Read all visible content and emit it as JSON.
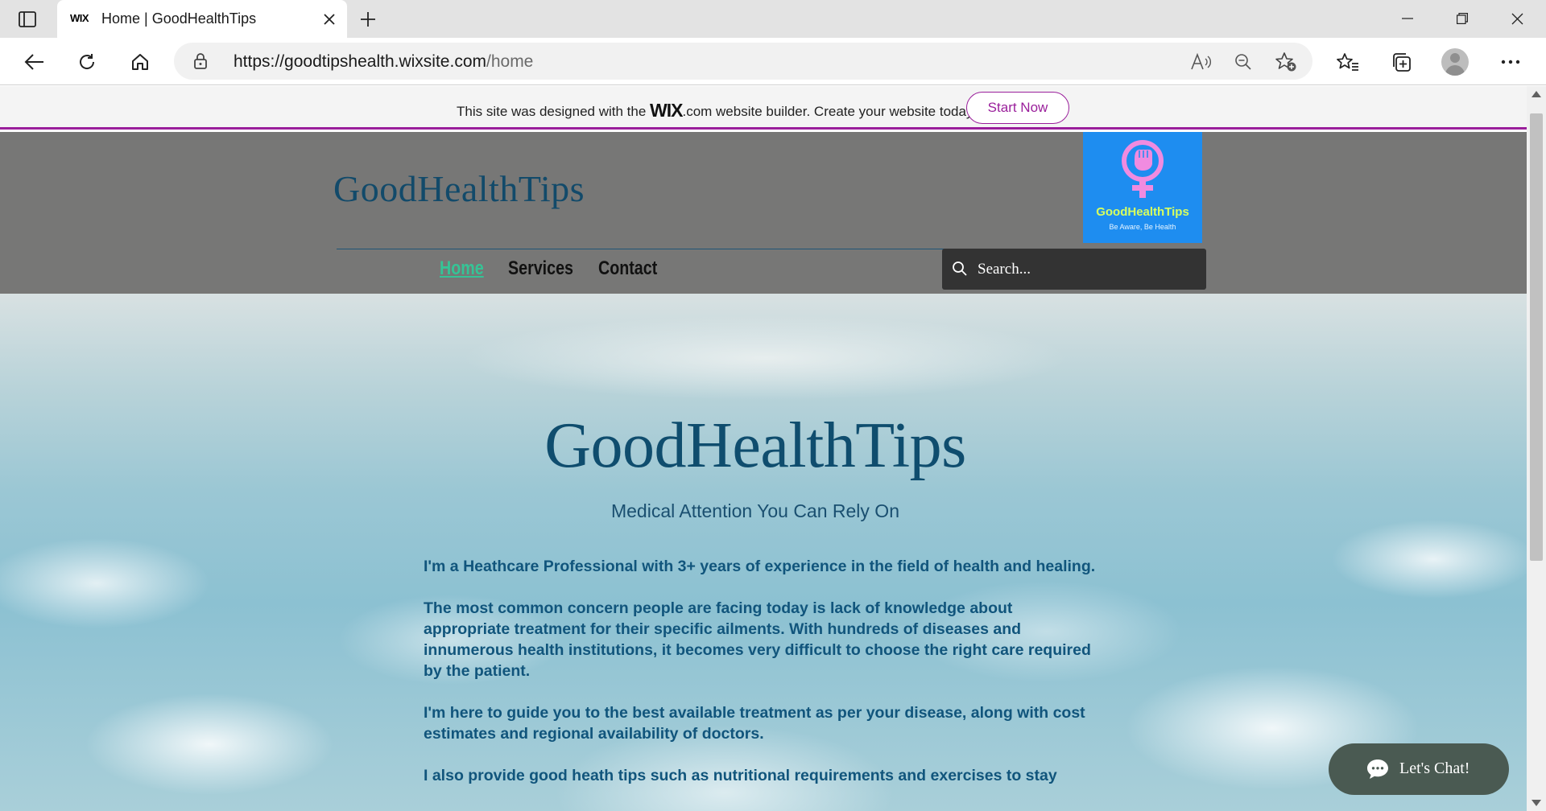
{
  "browser": {
    "tab_title": "Home | GoodHealthTips",
    "tab_favicon_text": "WIX",
    "url_host": "https://goodtipshealth.wixsite.com",
    "url_path": "/home"
  },
  "wix_banner": {
    "message_before": "This site was designed with the ",
    "wix_logo": "WIX",
    "message_after": ".com website builder. Create your website today.",
    "cta_label": "Start Now",
    "accent_color": "#9a1f9b"
  },
  "header": {
    "brand": "GoodHealthTips",
    "logo_name": "GoodHealthTips",
    "logo_tagline": "Be Aware, Be Health",
    "nav": [
      {
        "label": "Home",
        "active": true
      },
      {
        "label": "Services",
        "active": false
      },
      {
        "label": "Contact",
        "active": false
      }
    ],
    "search_placeholder": "Search...",
    "active_color": "#35c496"
  },
  "hero": {
    "title": "GoodHealthTips",
    "subtitle": "Medical Attention You Can Rely On",
    "paragraphs": [
      "I'm a Heathcare Professional with 3+ years of experience in the field of health and healing.",
      "The most common concern people are facing today is lack of knowledge about appropriate treatment for their specific ailments. With hundreds of diseases and innumerous health institutions, it becomes very difficult to choose the right care required by the patient.",
      "I'm here to guide you to the best available treatment as per your disease, along with cost estimates and regional availability of doctors.",
      "I also provide good heath tips such as nutritional requirements and exercises to stay"
    ]
  },
  "chat": {
    "label": "Let's Chat!"
  }
}
